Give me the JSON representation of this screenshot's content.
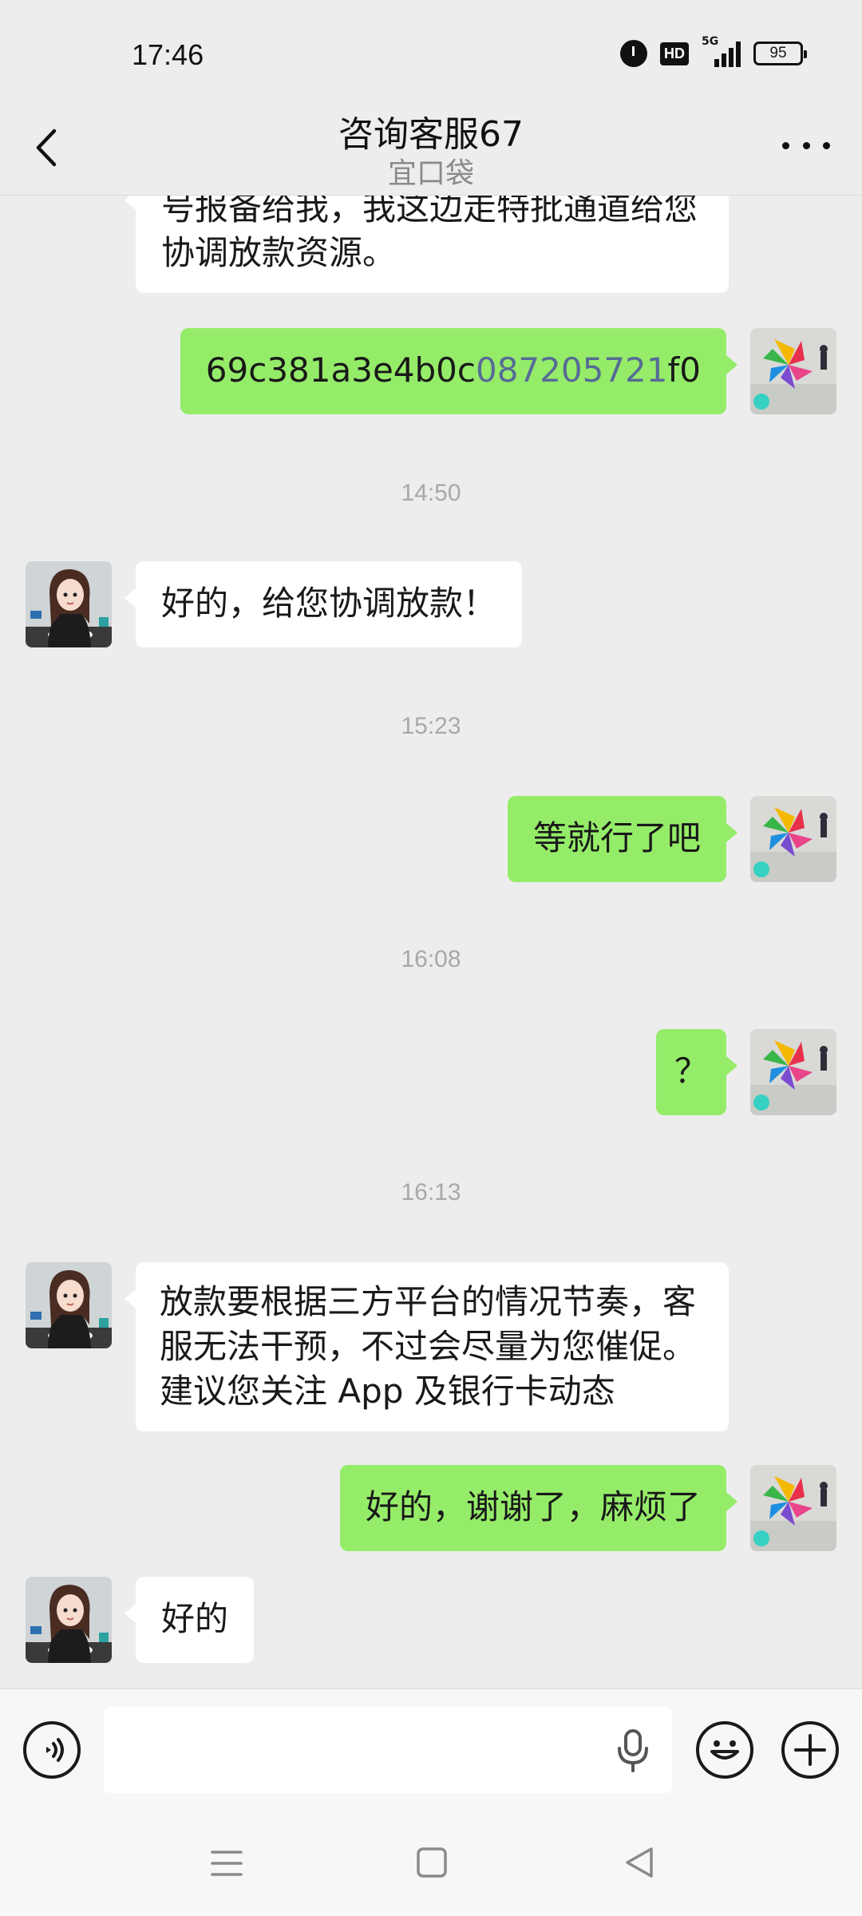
{
  "status_bar": {
    "time": "17:46",
    "hd_label": "HD",
    "network": "5G",
    "battery": "95",
    "icons": [
      "alarm-icon",
      "hd-icon",
      "signal-icon",
      "battery-icon"
    ]
  },
  "header": {
    "title": "咨询客服67",
    "subtitle": "宜口袋",
    "back_icon": "chevron-left-icon",
    "more_icon": "more-dots-icon"
  },
  "messages": [
    {
      "type": "in",
      "text": "号报备给我，我这边走特批通道给您协调放款资源。"
    },
    {
      "type": "out",
      "text_parts": [
        "69c381a3e4b0c",
        "087205721",
        "f0"
      ]
    },
    {
      "type": "time",
      "text": "14:50"
    },
    {
      "type": "in",
      "text": "好的，给您协调放款！"
    },
    {
      "type": "time",
      "text": "15:23"
    },
    {
      "type": "out",
      "text": "等就行了吧"
    },
    {
      "type": "time",
      "text": "16:08"
    },
    {
      "type": "out",
      "text": "？"
    },
    {
      "type": "time",
      "text": "16:13"
    },
    {
      "type": "in",
      "text": "放款要根据三方平台的情况节奏，客服无法干预，不过会尽量为您催促。建议您关注 App 及银行卡动态"
    },
    {
      "type": "out",
      "text": "好的，谢谢了，麻烦了"
    },
    {
      "type": "in",
      "text": "好的"
    }
  ],
  "input_bar": {
    "voice_icon": "voice-mode-icon",
    "mic_icon": "microphone-icon",
    "emoji_icon": "emoji-icon",
    "plus_icon": "plus-icon",
    "value": ""
  },
  "nav_bar": {
    "icons": [
      "menu-icon",
      "home-icon",
      "back-triangle-icon"
    ]
  },
  "colors": {
    "background": "#ededed",
    "bubble_out": "#95ec69",
    "bubble_in": "#ffffff",
    "link": "#576b95",
    "timestamp": "#a8a8a8"
  }
}
